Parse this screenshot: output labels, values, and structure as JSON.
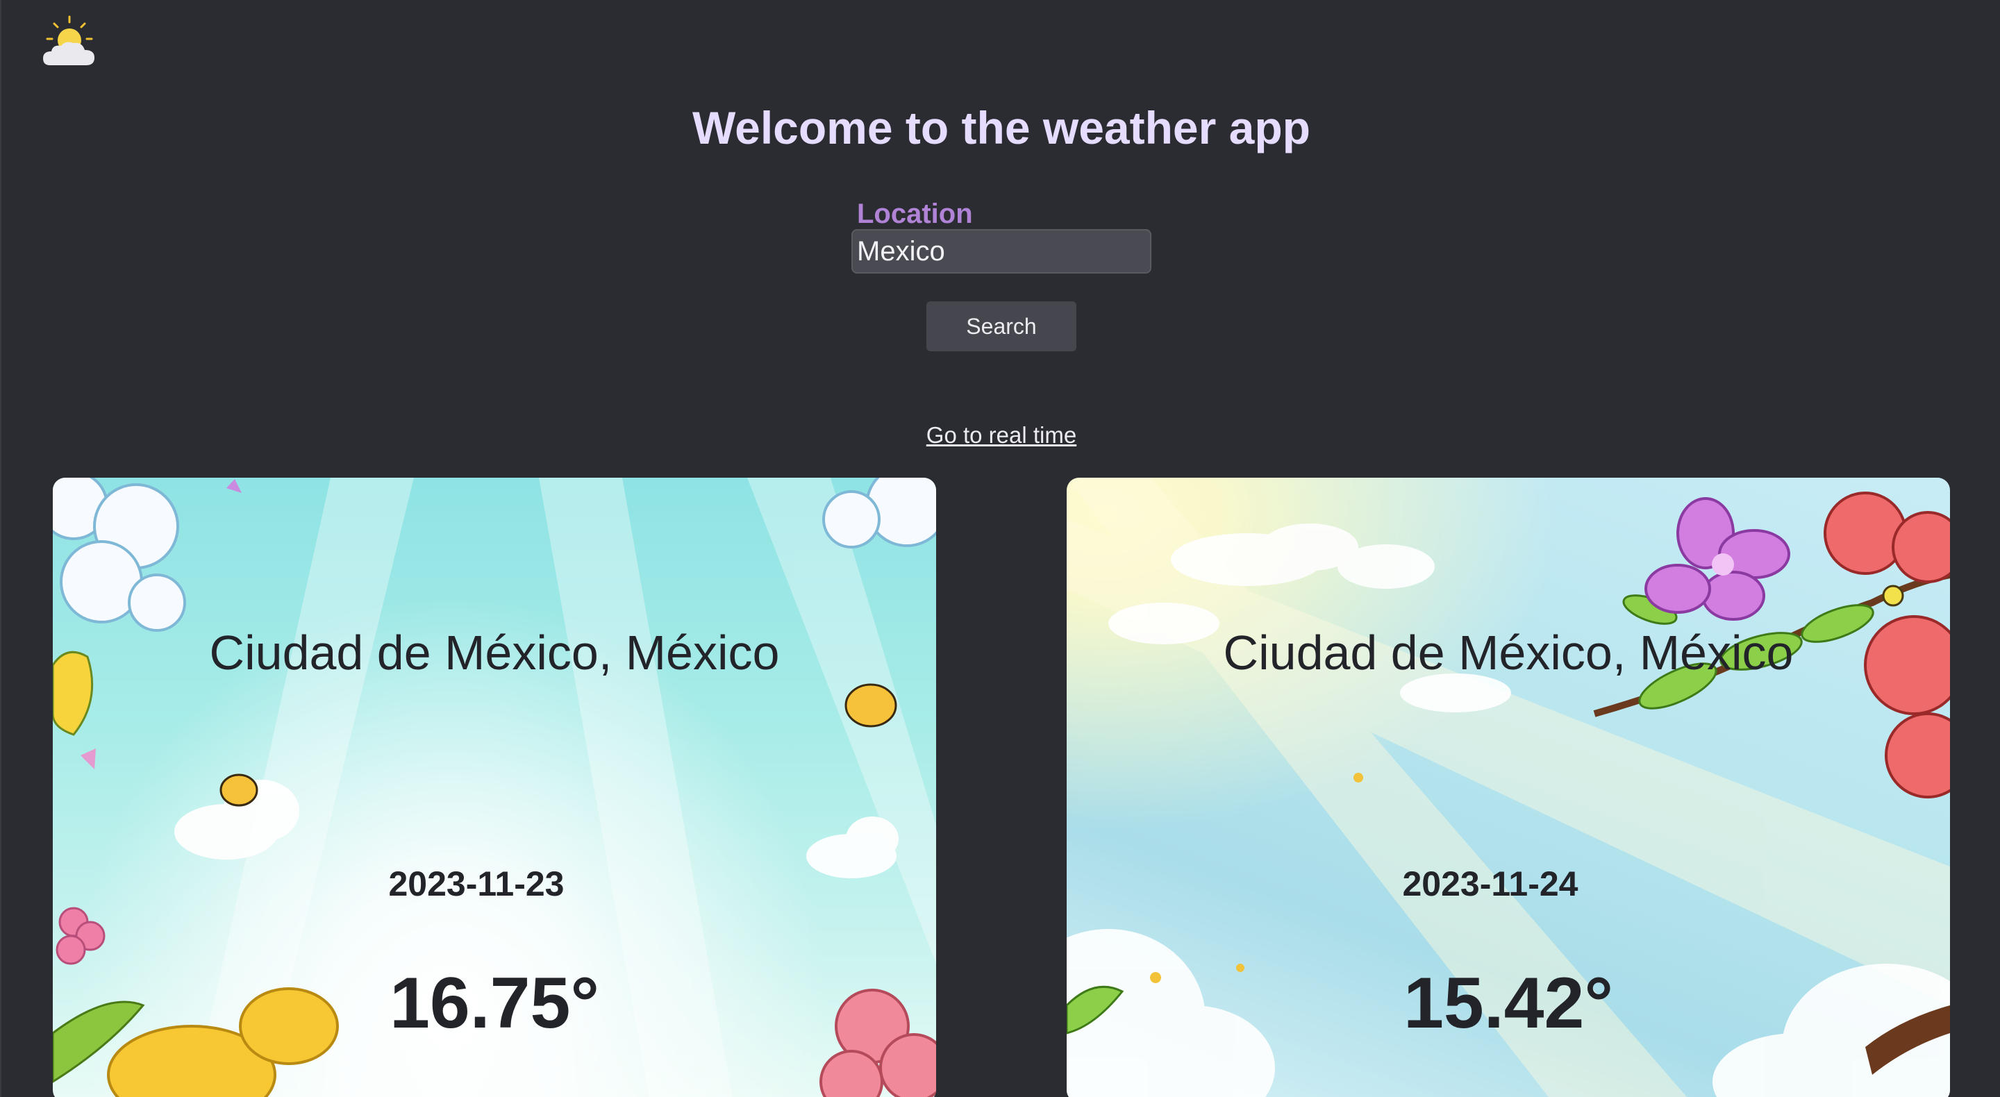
{
  "header": {
    "logo_icon": "sun-behind-cloud-icon",
    "title": "Welcome to the weather app"
  },
  "search": {
    "label": "Location",
    "value": "Mexico",
    "button_label": "Search"
  },
  "nav": {
    "realtime_link": "Go to real time"
  },
  "forecast": [
    {
      "location": "Ciudad de México, México",
      "date": "2023-11-23",
      "temperature": "16.75°"
    },
    {
      "location": "Ciudad de México, México",
      "date": "2023-11-24",
      "temperature": "15.42°"
    }
  ],
  "colors": {
    "background": "#2b2c31",
    "title": "#e6dcff",
    "label": "#b083d6"
  }
}
